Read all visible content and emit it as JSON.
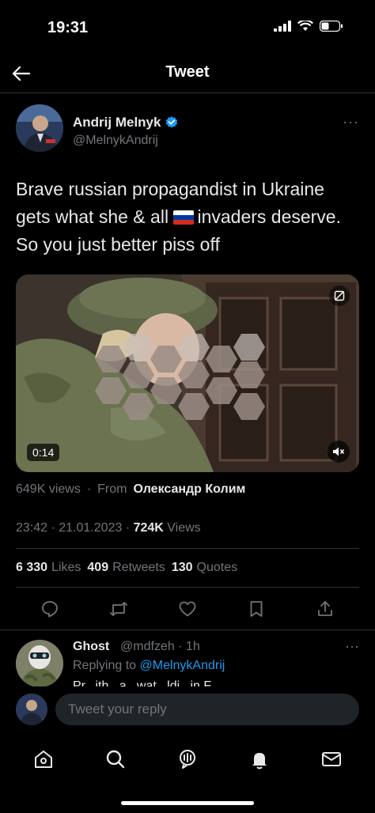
{
  "status_bar": {
    "time": "19:31"
  },
  "nav": {
    "title": "Tweet"
  },
  "tweet": {
    "author_name": "Andrij Melnyk",
    "author_handle": "@MelnykAndrij",
    "text_part1": "Brave russian propagandist in Ukraine gets what she & all ",
    "text_part2": "invaders deserve. So you just better piss off",
    "flag_colors": [
      "#ffffff",
      "#0039a6",
      "#d52b1e"
    ],
    "video_duration": "0:14",
    "views_label": "649K views",
    "from_label": "From",
    "from_name": "Олександр Колим",
    "timestamp": "23:42 · 21.01.2023 · ",
    "view_count": "724K",
    "view_word": " Views",
    "likes_count": "6 330",
    "likes_label": "Likes",
    "retweets_count": "409",
    "retweets_label": "Retweets",
    "quotes_count": "130",
    "quotes_label": "Quotes"
  },
  "reply": {
    "name": "Ghost",
    "handle_time": "@mdfzeh · 1h",
    "replying_prefix": "Replying to ",
    "replying_mention": "@MelnykAndrij",
    "cut_text": "Pr...ith...a...wat...ldi...in F..."
  },
  "composer": {
    "placeholder": "Tweet your reply"
  },
  "icons": {
    "back": "arrow-left-icon",
    "verified": "verified-badge-icon",
    "mute": "speaker-muted-icon",
    "reply": "comment-icon",
    "retweet": "retweet-icon",
    "like": "heart-icon",
    "bookmark": "bookmark-icon",
    "share": "share-icon",
    "home": "home-icon",
    "search": "search-icon",
    "spaces": "spaces-icon",
    "notifications": "bell-icon",
    "messages": "mail-icon"
  },
  "colors": {
    "background": "#000000",
    "accent": "#1d9bf0",
    "muted": "#71767b",
    "text": "#e7e9ea"
  }
}
